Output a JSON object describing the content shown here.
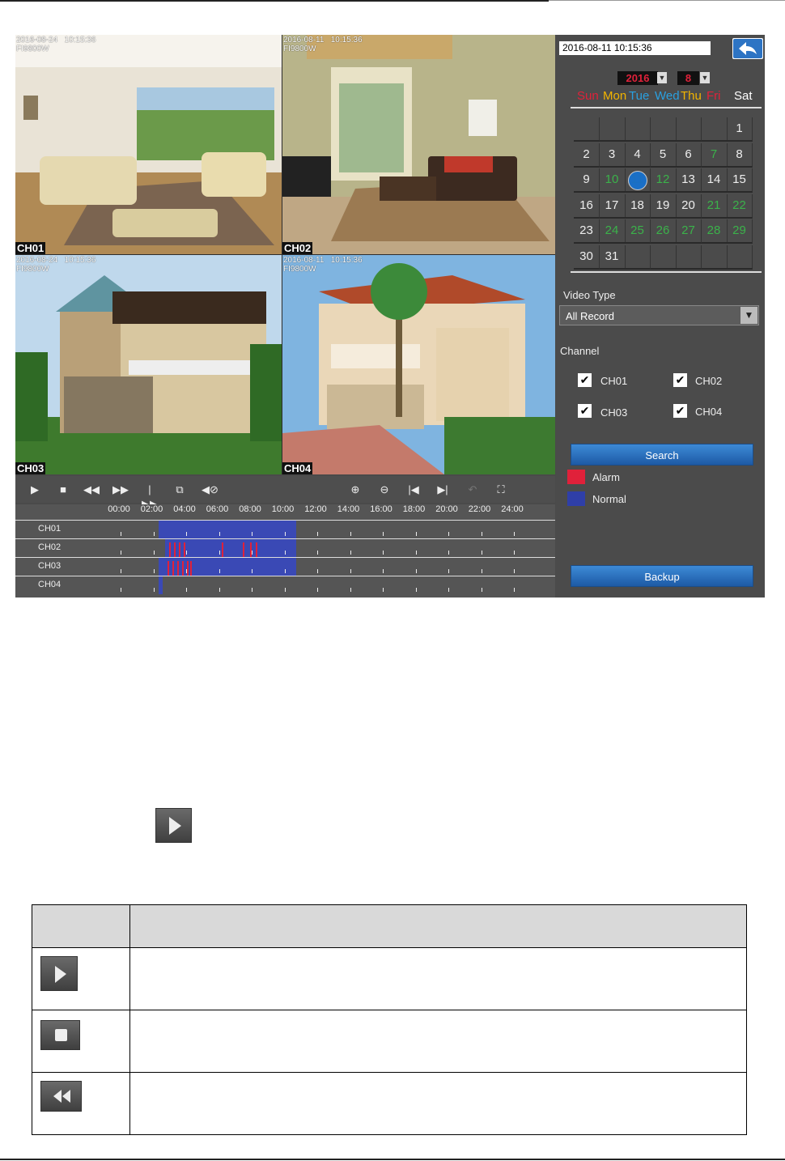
{
  "cameras": [
    {
      "osd_date": "2016-08-24   10:15:36",
      "osd_model": "FI9800W",
      "label": "CH01"
    },
    {
      "osd_date": "2016-08-11   10:15:36",
      "osd_model": "FI9800W",
      "label": "CH02"
    },
    {
      "osd_date": "2016-08-24   10:15:36",
      "osd_model": "FI9800W",
      "label": "CH03"
    },
    {
      "osd_date": "2016-08-11   10:15:36",
      "osd_model": "FI9800W",
      "label": "CH04"
    }
  ],
  "panel": {
    "datetime": "2016-08-11      10:15:36",
    "year": "2016",
    "month": "8",
    "weekdays": [
      "Sun",
      "Mon",
      "Tue",
      "Wed",
      "Thu",
      "Fri",
      "Sat"
    ],
    "weekday_colors": [
      "#e0213a",
      "#f2b400",
      "#2aa0e0",
      "#2aa0e0",
      "#f2b400",
      "#e0213a",
      "#ffffff"
    ],
    "video_type_label": "Video Type",
    "video_type_value": "All Record",
    "channel_label": "Channel",
    "channels": [
      "CH01",
      "CH02",
      "CH03",
      "CH04"
    ],
    "search_label": "Search",
    "legend": [
      {
        "label": "Alarm",
        "color": "#e0213a"
      },
      {
        "label": "Normal",
        "color": "#2f3fa8"
      }
    ],
    "backup_label": "Backup"
  },
  "timeline": {
    "hours": [
      "00:00",
      "02:00",
      "04:00",
      "06:00",
      "08:00",
      "10:00",
      "12:00",
      "14:00",
      "16:00",
      "18:00",
      "20:00",
      "22:00",
      "24:00"
    ],
    "rows": [
      "CH01",
      "CH02",
      "CH03",
      "CH04"
    ]
  },
  "calendar": {
    "selected_day": "11",
    "weeks": [
      [
        "",
        "",
        "",
        "",
        "",
        "",
        "1"
      ],
      [
        "2",
        "3",
        "4",
        "5",
        "6",
        "7",
        "8"
      ],
      [
        "9",
        "10",
        "11",
        "12",
        "13",
        "14",
        "15"
      ],
      [
        "16",
        "17",
        "18",
        "19",
        "20",
        "21",
        "22"
      ],
      [
        "23",
        "24",
        "25",
        "26",
        "27",
        "28",
        "29"
      ],
      [
        "30",
        "31",
        "",
        "",
        "",
        "",
        ""
      ]
    ],
    "green_days": [
      "7",
      "10",
      "12",
      "21",
      "22",
      "24",
      "25",
      "26",
      "27",
      "28",
      "29"
    ]
  },
  "toolbar_icons": [
    "play-icon",
    "stop-icon",
    "rewind-icon",
    "fast-forward-icon",
    "step-forward-icon",
    "clip-icon",
    "mute-icon",
    "zoom-in-icon",
    "zoom-out-icon",
    "prev-icon",
    "next-icon",
    "undo-icon",
    "fullscreen-icon"
  ],
  "colors": {
    "panel_bg": "#4b4b4b",
    "record_normal": "#3a49b5",
    "record_alarm": "#e0213a",
    "accent": "#1a6fc7"
  }
}
